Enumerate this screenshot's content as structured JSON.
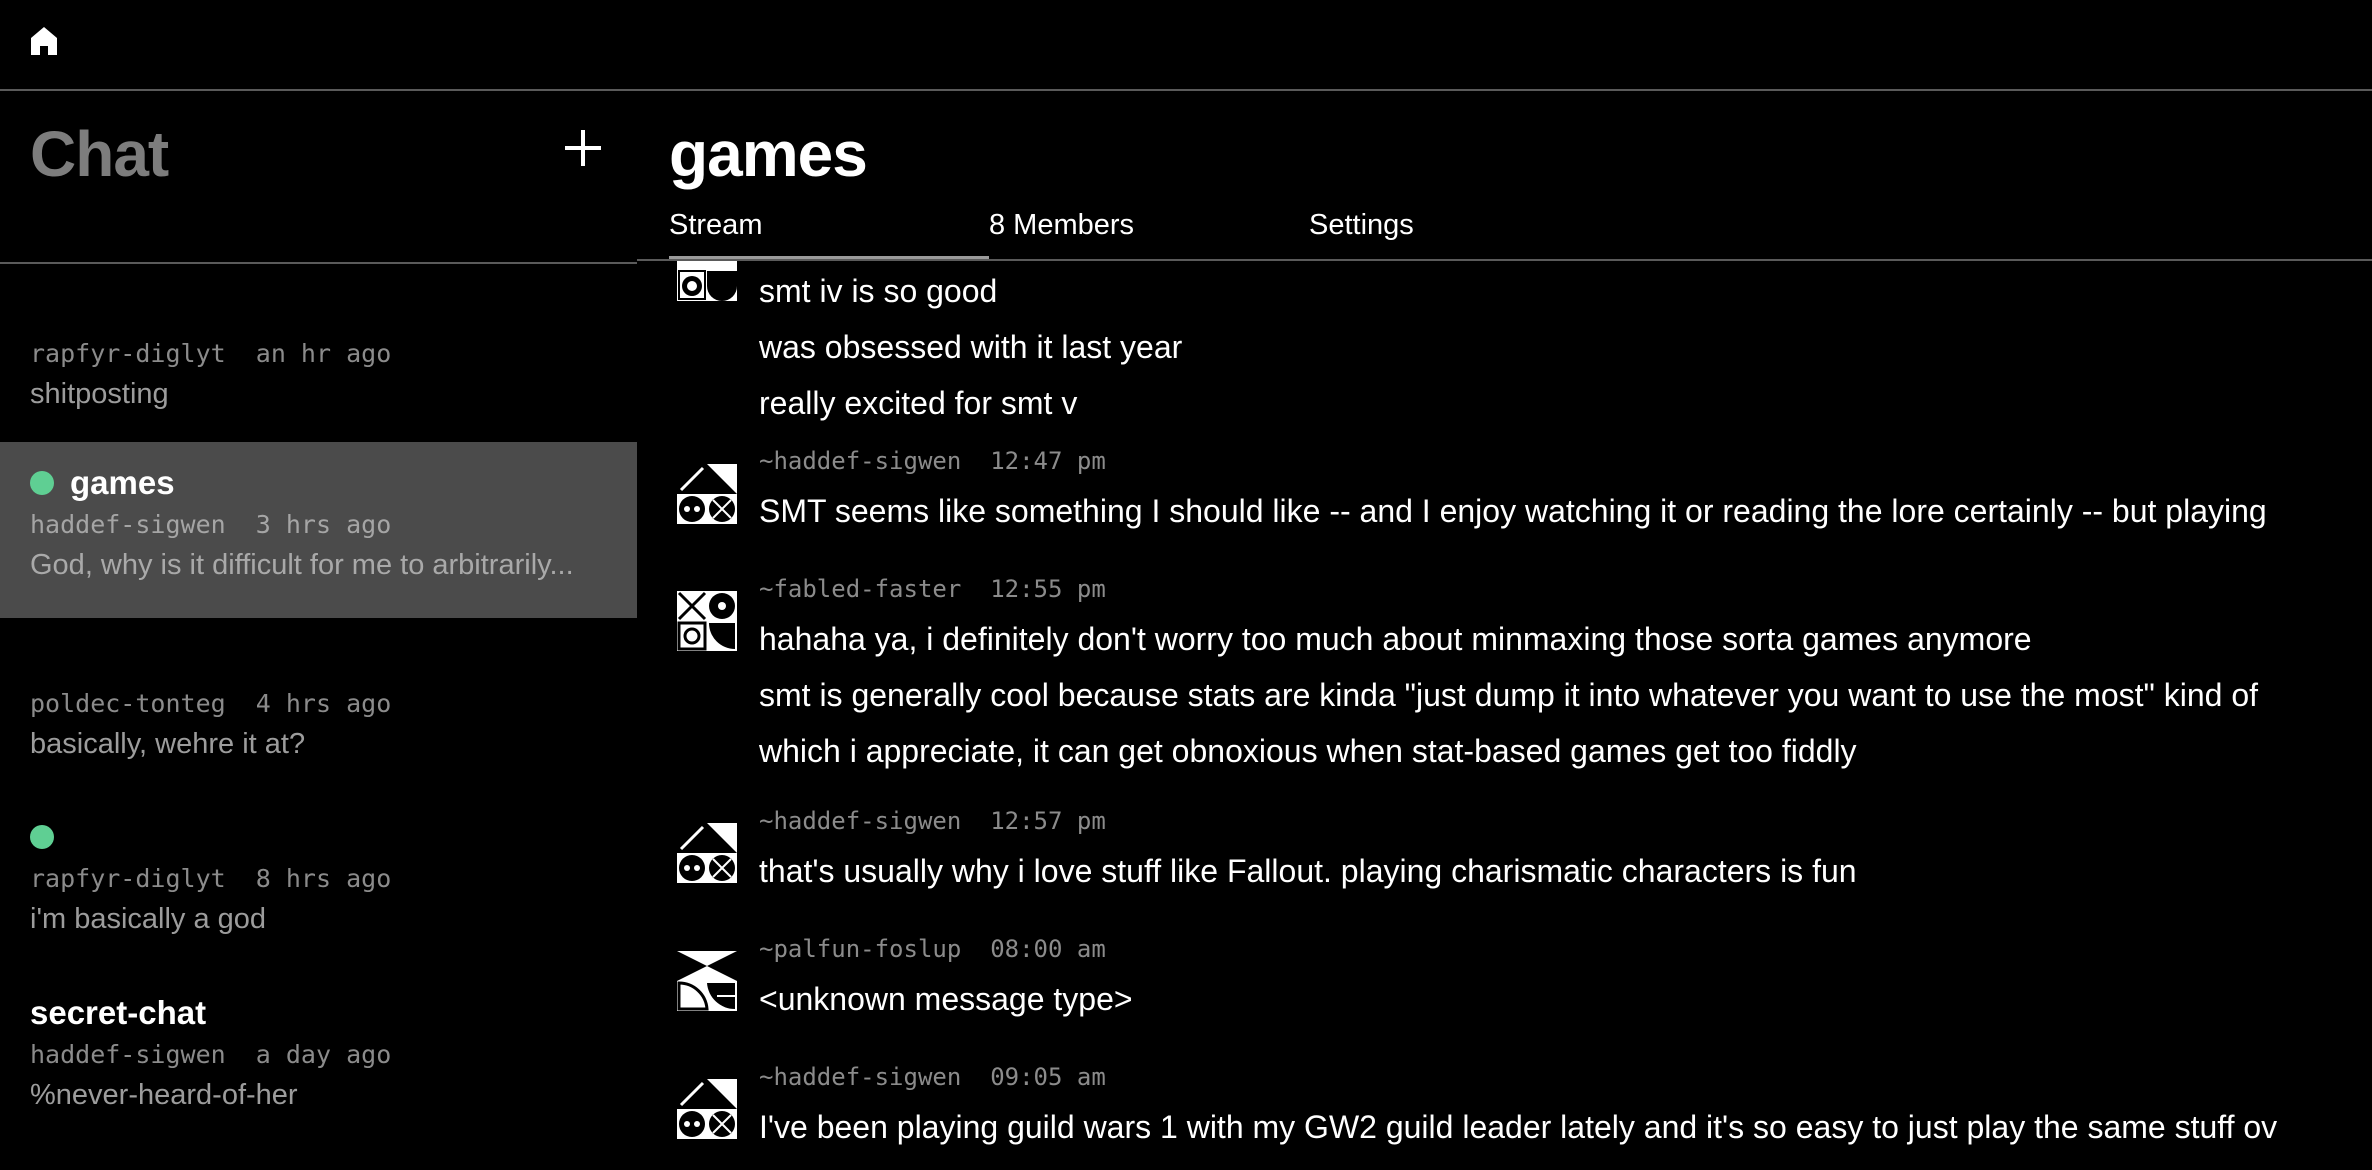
{
  "sidebar": {
    "title": "Chat",
    "conversations": [
      {
        "title": "",
        "author": "rapfyr-diglyt",
        "time": "an hr ago",
        "preview": "shitposting",
        "unread": false
      },
      {
        "title": "games",
        "author": "haddef-sigwen",
        "time": "3 hrs ago",
        "preview": "God, why is it difficult for me to arbitrarily...",
        "unread": true
      },
      {
        "title": "",
        "author": "poldec-tonteg",
        "time": "4 hrs ago",
        "preview": "basically, wehre it at?",
        "unread": false
      },
      {
        "title": "",
        "author": "rapfyr-diglyt",
        "time": "8 hrs ago",
        "preview": "i'm basically a god",
        "unread": true
      },
      {
        "title": "secret-chat",
        "author": "haddef-sigwen",
        "time": "a day ago",
        "preview": "%never-heard-of-her",
        "unread": false
      }
    ]
  },
  "main": {
    "title": "games",
    "tabs": [
      "Stream",
      "8 Members",
      "Settings"
    ],
    "messages": [
      {
        "author": "",
        "time": "",
        "lines": [
          "smt iv is so good",
          "was obsessed with it last year",
          "really excited for smt v"
        ]
      },
      {
        "author": "~haddef-sigwen",
        "time": "12:47 pm",
        "lines": [
          "SMT seems like something I should like -- and I enjoy watching it or reading the lore certainly -- but playing"
        ]
      },
      {
        "author": "~fabled-faster",
        "time": "12:55 pm",
        "lines": [
          "hahaha ya, i definitely don't worry too much about minmaxing those sorta games anymore",
          "smt is generally cool because stats are kinda \"just dump it into whatever you want to use the most\" kind of",
          "which i appreciate, it can get obnoxious when stat-based games get too fiddly"
        ]
      },
      {
        "author": "~haddef-sigwen",
        "time": "12:57 pm",
        "lines": [
          "that's usually why i love stuff like Fallout. playing charismatic characters is fun"
        ]
      },
      {
        "author": "~palfun-foslup",
        "time": "08:00 am",
        "lines": [
          "<unknown message type>"
        ]
      },
      {
        "author": "~haddef-sigwen",
        "time": "09:05 am",
        "lines": [
          "I've been playing guild wars 1 with my GW2 guild leader lately and it's so easy to just play the same stuff ov"
        ]
      }
    ]
  }
}
